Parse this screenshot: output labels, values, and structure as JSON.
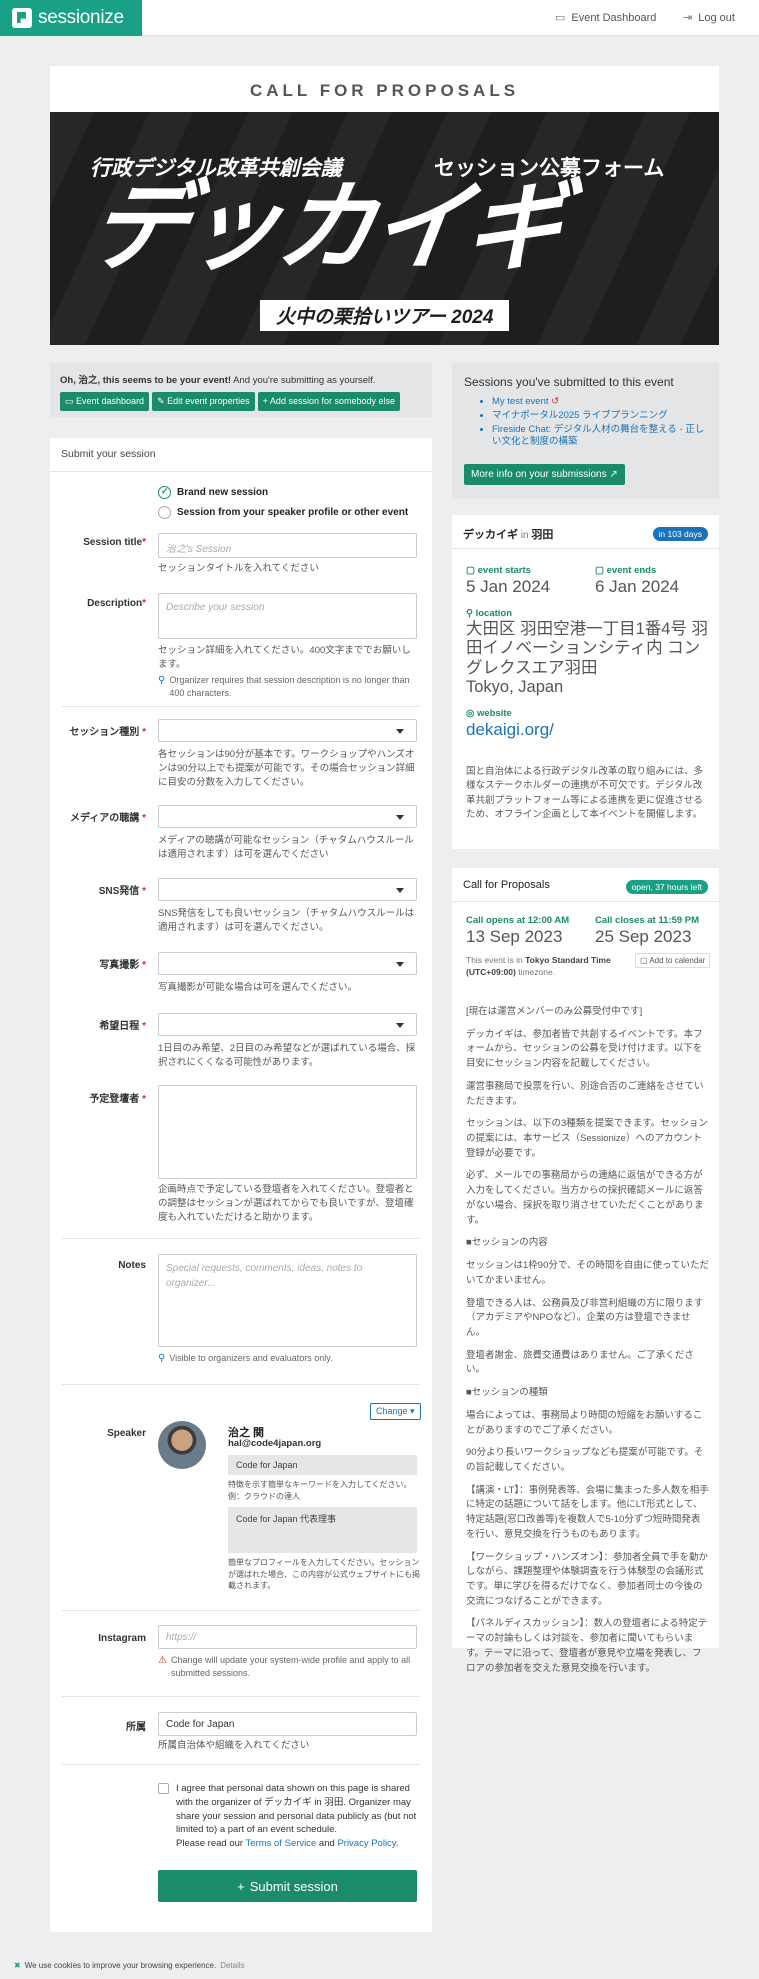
{
  "nav": {
    "logo": "sessionize",
    "event_dashboard": "Event Dashboard",
    "logout": "Log out"
  },
  "page": {
    "title": "CALL FOR PROPOSALS"
  },
  "banner": {
    "left": "行政デジタル改革共創会議",
    "right": "セッション公募フォーム",
    "big": "デッカイギ",
    "sub": "火中の栗拾いツアー 2024"
  },
  "notice": {
    "bold": "Oh, 治之, this seems to be your event!",
    "rest": " And you're submitting as yourself.",
    "buttons": [
      "Event dashboard",
      "Edit event properties",
      "+ Add session for somebody else"
    ]
  },
  "form": {
    "heading": "Submit your session",
    "radio_new": "Brand new session",
    "radio_profile": "Session from your speaker profile or other event",
    "title_label": "Session title",
    "title_placeholder": "治之's Session",
    "title_help": "セッションタイトルを入れてください",
    "desc_label": "Description",
    "desc_placeholder": "Describe your session",
    "desc_help": "セッション詳細を入れてください。400文字まででお願いします。",
    "desc_hint": "Organizer requires that session description is no longer than 400 characters.",
    "type_label": "セッション種別",
    "type_help": "各セッションは90分が基本です。ワークショップやハンズオンは90分以上でも提案が可能です。その場合セッション詳細に目安の分数を入力してください。",
    "media_label": "メディアの聴講",
    "media_help": "メディアの聴講が可能なセッション（チャタムハウスルールは適用されます）は可を選んでください",
    "sns_label": "SNS発信",
    "sns_help": "SNS発信をしても良いセッション（チャタムハウスルールは適用されます）は可を選んでください。",
    "photo_label": "写真撮影",
    "photo_help": "写真撮影が可能な場合は可を選んでください。",
    "date_label": "希望日程",
    "date_help": "1日目のみ希望、2日目のみ希望などが選ばれている場合、採択されにくくなる可能性があります。",
    "speakers_label": "予定登壇者",
    "speakers_help": "企画時点で予定している登壇者を入れてください。登壇者との調整はセッションが選ばれてからでも良いですが、登壇確度も入れていただけると助かります。",
    "notes_label": "Notes",
    "notes_placeholder": "Special requests, comments, ideas, notes to organizer...",
    "notes_hint": "Visible to organizers and evaluators only.",
    "speaker_label": "Speaker",
    "change": "Change ▾",
    "speaker_name": "治之 関",
    "speaker_email": "hal@code4japan.org",
    "tagline": "Code for Japan",
    "tagline_help": "特徴を示す簡単なキーワードを入力してください。例：クラウドの達人",
    "bio": "Code for Japan 代表理事",
    "bio_help": "簡単なプロフィールを入力してください。セッションが選ばれた場合、この内容が公式ウェブサイトにも掲載されます。",
    "instagram_label": "Instagram",
    "instagram_placeholder": "https://",
    "instagram_hint": "Change will update your system-wide profile and apply to all submitted sessions.",
    "affil_label": "所属",
    "affil_value": "Code for Japan",
    "affil_help": "所属自治体や組織を入れてください",
    "consent": "I agree that personal data shown on this page is shared with the organizer of デッカイギ in 羽田. Organizer may share your session and personal data publicly as (but not limited to) a part of an event schedule.",
    "consent_read": "Please read our ",
    "tos": "Terms of Service",
    "and": " and ",
    "privacy": "Privacy Policy",
    "period": ".",
    "submit": "Submit session"
  },
  "submitted": {
    "title": "Sessions you've submitted to this event",
    "items": [
      "My test event",
      "マイナポータル2025 ライブプランニング",
      "Fireside Chat: デジタル人材の舞台を整える - 正しい文化と制度の構築"
    ],
    "more": "More info on your submissions"
  },
  "event": {
    "name": "デッカイギ",
    "in": " in ",
    "place": "羽田",
    "badge": "in 103 days",
    "starts_label": "event starts",
    "starts": "5 Jan 2024",
    "ends_label": "event ends",
    "ends": "6 Jan 2024",
    "location_label": "location",
    "location": "大田区 羽田空港一丁目1番4号 羽田イノベーションシティ内 コングレクスエア羽田",
    "country": "Tokyo, Japan",
    "website_label": "website",
    "website": "dekaigi.org/",
    "description": "国と自治体による行政デジタル改革の取り組みには、多様なステークホルダーの連携が不可欠です。デジタル改革共創プラットフォーム等による連携を更に促進させるため、オフライン企画として本イベントを開催します。"
  },
  "cfp": {
    "title": "Call for Proposals",
    "badge": "open, 37 hours left",
    "opens_label": "Call opens at 12:00 AM",
    "opens": "13 Sep 2023",
    "closes_label": "Call closes at 11:59 PM",
    "closes": "25 Sep 2023",
    "tz_prefix": "This event is in ",
    "tz": "Tokyo Standard Time (UTC+09:00)",
    "tz_suffix": " timezone.",
    "add_calendar": "Add to calendar",
    "paragraphs": [
      "[現在は運営メンバーのみ公募受付中です]",
      "デッカイギは、参加者皆で共創するイベントです。本フォームから、セッションの公募を受け付けます。以下を目安にセッション内容を記載してください。",
      "運営事務局で投票を行い、別途合否のご連絡をさせていただきます。",
      "セッションは、以下の3種類を提案できます。セッションの提案には、本サービス（Sessionize）へのアカウント登録が必要です。",
      "必ず、メールでの事務局からの連絡に返信ができる方が入力をしてください。当方からの採択確認メールに返答がない場合、採択を取り消させていただくことがあります。",
      "■セッションの内容",
      "セッションは1枠90分で、その時間を自由に使っていただいてかまいません。",
      "登壇できる人は、公務員及び非営利組織の方に限ります（アカデミアやNPOなど）。企業の方は登壇できません。",
      "登壇者謝金、旅費交通費はありません。ご了承ください。",
      "■セッションの種類",
      "場合によっては、事務局より時間の短縮をお願いすることがありますのでご了承ください。",
      "90分より長いワークショップなども提案が可能です。その旨記載してください。",
      "【講演・LT】：事例発表等、会場に集まった多人数を相手に特定の話題について話をします。他にLT形式として、特定話題(窓口改善等)を複数人で5-10分ずつ短時間発表を行い、意見交換を行うものもあります。",
      "【ワークショップ・ハンズオン】：参加者全員で手を動かしながら、課題整理や体験調査を行う体験型の会議形式です。単に学びを得るだけでなく、参加者同士の今後の交流につなげることができます。",
      "【パネルディスカッション】：数人の登壇者による特定テーマの討論もしくは対談を、参加者に聞いてもらいます。テーマに沿って、登壇者が意見や立場を発表し、フロアの参加者を交えた意見交換を行います。"
    ]
  },
  "cookie": {
    "text": "We use cookies to improve your browsing experience.",
    "details": "Details"
  }
}
